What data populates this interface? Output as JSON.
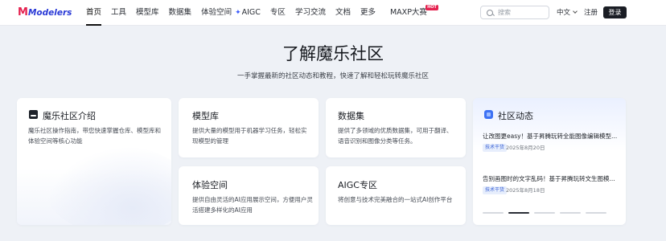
{
  "logo": {
    "mark": "M",
    "text": "Modelers"
  },
  "nav": {
    "items": [
      {
        "label": "首页",
        "active": true
      },
      {
        "label": "工具"
      },
      {
        "label": "模型库"
      },
      {
        "label": "数据集"
      },
      {
        "label": "体验空间"
      },
      {
        "label": "AIGC"
      },
      {
        "label": "专区"
      },
      {
        "label": "学习交流"
      },
      {
        "label": "文档"
      },
      {
        "label": "更多"
      },
      {
        "label": "MAXP大赛",
        "badge": "HOT"
      }
    ],
    "search_placeholder": "搜索",
    "language": "中文",
    "register": "注册",
    "login": "登录"
  },
  "hero": {
    "title": "了解魔乐社区",
    "subtitle": "一手掌握最新的社区动态和教程，快速了解和轻松玩转魔乐社区"
  },
  "cards": {
    "intro": {
      "title": "魔乐社区介绍",
      "desc": "魔乐社区操作指南，带您快速掌握仓库、模型库和体验空间等核心功能"
    },
    "models": {
      "title": "模型库",
      "desc": "提供大量的模型用于机器学习任务，轻松实现模型的管理"
    },
    "datasets": {
      "title": "数据集",
      "desc": "提供了多领域的优质数据集，可用于翻译、语音识别和图像分类等任务。"
    },
    "spaces": {
      "title": "体验空间",
      "desc": "提供自由灵活的AI应用展示空间，方便用户灵活搭建多样化的AI应用"
    },
    "aigc": {
      "title": "AIGC专区",
      "desc": "将创意与技术完美融合的一站式AI创作平台"
    }
  },
  "social": {
    "title": "社区动态",
    "posts": [
      {
        "title": "让改图更easy！基于昇腾玩转全能图像编辑模型...",
        "tag": "技术干货",
        "date": "2025年8月20日"
      },
      {
        "title": "告别画图时的文字乱码！基于昇腾玩转文生图模...",
        "tag": "技术干货",
        "date": "2025年8月18日"
      }
    ],
    "carousel_count": 5,
    "carousel_active": 1
  },
  "colors": {
    "accent": "#3d72f4",
    "hot": "#e5214f",
    "brand_blue": "#2a3ad6"
  }
}
